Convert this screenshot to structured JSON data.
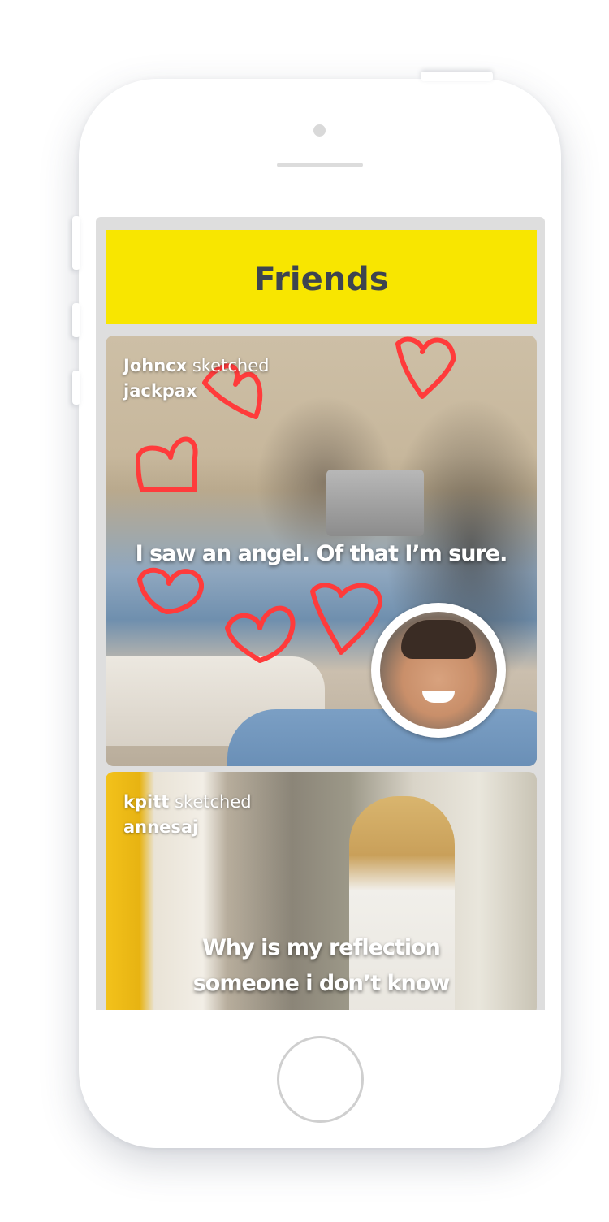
{
  "header": {
    "title": "Friends"
  },
  "feed": [
    {
      "user": "Johncx",
      "action": "sketched",
      "target": "jackpax",
      "caption": "I saw an angel. Of that I’m sure."
    },
    {
      "user": "kpitt",
      "action": "sketched",
      "target": "annesaj",
      "caption_line1": "Why is my reflection",
      "caption_line2": "someone i don’t know"
    }
  ],
  "colors": {
    "header_background": "#f8e600",
    "title_text": "#3d4450",
    "sketch_stroke": "#ff3b3b",
    "screen_background": "#dedede"
  },
  "icons": {
    "sketch": "heart-sketch-icon"
  }
}
